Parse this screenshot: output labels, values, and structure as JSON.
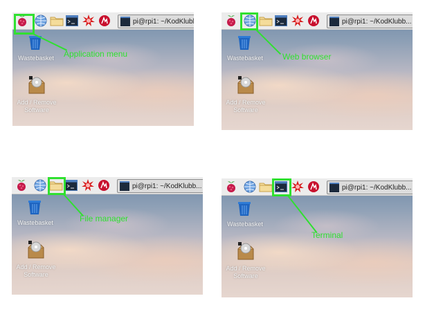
{
  "panels": [
    {
      "callout": "Application menu",
      "desktop": {
        "wastebasket": "Wastebasket",
        "addremove": "Add / Remove Software"
      },
      "terminal_title": "pi@rpi1: ~/KodKlubb..."
    },
    {
      "callout": "Web browser",
      "desktop": {
        "wastebasket": "Wastebasket",
        "addremove": "Add / Remove Software"
      },
      "terminal_title": "pi@rpi1: ~/KodKlubb..."
    },
    {
      "callout": "File manager",
      "desktop": {
        "wastebasket": "Wastebasket",
        "addremove": "Add / Remove Software"
      },
      "terminal_title": "pi@rpi1: ~/KodKlubb..."
    },
    {
      "callout": "Terminal",
      "desktop": {
        "wastebasket": "Wastebasket",
        "addremove": "Add / Remove Software"
      },
      "terminal_title": "pi@rpi1: ~/KodKlubb..."
    }
  ],
  "taskbar_icons": [
    "raspberry-menu-icon",
    "globe-icon",
    "folder-icon",
    "terminal-icon",
    "burst-icon",
    "wolfram-icon"
  ],
  "colors": {
    "highlight": "#30e030"
  }
}
